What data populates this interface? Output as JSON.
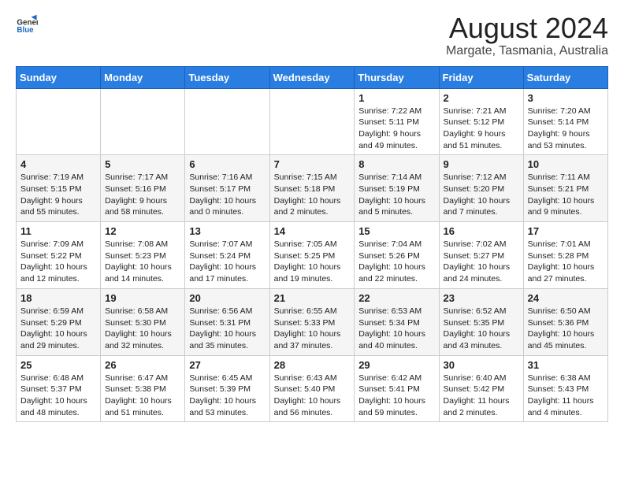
{
  "logo": {
    "text_general": "General",
    "text_blue": "Blue"
  },
  "title": "August 2024",
  "subtitle": "Margate, Tasmania, Australia",
  "days_header": [
    "Sunday",
    "Monday",
    "Tuesday",
    "Wednesday",
    "Thursday",
    "Friday",
    "Saturday"
  ],
  "weeks": [
    {
      "days": [
        {
          "num": "",
          "info": ""
        },
        {
          "num": "",
          "info": ""
        },
        {
          "num": "",
          "info": ""
        },
        {
          "num": "",
          "info": ""
        },
        {
          "num": "1",
          "info": "Sunrise: 7:22 AM\nSunset: 5:11 PM\nDaylight: 9 hours\nand 49 minutes."
        },
        {
          "num": "2",
          "info": "Sunrise: 7:21 AM\nSunset: 5:12 PM\nDaylight: 9 hours\nand 51 minutes."
        },
        {
          "num": "3",
          "info": "Sunrise: 7:20 AM\nSunset: 5:14 PM\nDaylight: 9 hours\nand 53 minutes."
        }
      ]
    },
    {
      "days": [
        {
          "num": "4",
          "info": "Sunrise: 7:19 AM\nSunset: 5:15 PM\nDaylight: 9 hours\nand 55 minutes."
        },
        {
          "num": "5",
          "info": "Sunrise: 7:17 AM\nSunset: 5:16 PM\nDaylight: 9 hours\nand 58 minutes."
        },
        {
          "num": "6",
          "info": "Sunrise: 7:16 AM\nSunset: 5:17 PM\nDaylight: 10 hours\nand 0 minutes."
        },
        {
          "num": "7",
          "info": "Sunrise: 7:15 AM\nSunset: 5:18 PM\nDaylight: 10 hours\nand 2 minutes."
        },
        {
          "num": "8",
          "info": "Sunrise: 7:14 AM\nSunset: 5:19 PM\nDaylight: 10 hours\nand 5 minutes."
        },
        {
          "num": "9",
          "info": "Sunrise: 7:12 AM\nSunset: 5:20 PM\nDaylight: 10 hours\nand 7 minutes."
        },
        {
          "num": "10",
          "info": "Sunrise: 7:11 AM\nSunset: 5:21 PM\nDaylight: 10 hours\nand 9 minutes."
        }
      ]
    },
    {
      "days": [
        {
          "num": "11",
          "info": "Sunrise: 7:09 AM\nSunset: 5:22 PM\nDaylight: 10 hours\nand 12 minutes."
        },
        {
          "num": "12",
          "info": "Sunrise: 7:08 AM\nSunset: 5:23 PM\nDaylight: 10 hours\nand 14 minutes."
        },
        {
          "num": "13",
          "info": "Sunrise: 7:07 AM\nSunset: 5:24 PM\nDaylight: 10 hours\nand 17 minutes."
        },
        {
          "num": "14",
          "info": "Sunrise: 7:05 AM\nSunset: 5:25 PM\nDaylight: 10 hours\nand 19 minutes."
        },
        {
          "num": "15",
          "info": "Sunrise: 7:04 AM\nSunset: 5:26 PM\nDaylight: 10 hours\nand 22 minutes."
        },
        {
          "num": "16",
          "info": "Sunrise: 7:02 AM\nSunset: 5:27 PM\nDaylight: 10 hours\nand 24 minutes."
        },
        {
          "num": "17",
          "info": "Sunrise: 7:01 AM\nSunset: 5:28 PM\nDaylight: 10 hours\nand 27 minutes."
        }
      ]
    },
    {
      "days": [
        {
          "num": "18",
          "info": "Sunrise: 6:59 AM\nSunset: 5:29 PM\nDaylight: 10 hours\nand 29 minutes."
        },
        {
          "num": "19",
          "info": "Sunrise: 6:58 AM\nSunset: 5:30 PM\nDaylight: 10 hours\nand 32 minutes."
        },
        {
          "num": "20",
          "info": "Sunrise: 6:56 AM\nSunset: 5:31 PM\nDaylight: 10 hours\nand 35 minutes."
        },
        {
          "num": "21",
          "info": "Sunrise: 6:55 AM\nSunset: 5:33 PM\nDaylight: 10 hours\nand 37 minutes."
        },
        {
          "num": "22",
          "info": "Sunrise: 6:53 AM\nSunset: 5:34 PM\nDaylight: 10 hours\nand 40 minutes."
        },
        {
          "num": "23",
          "info": "Sunrise: 6:52 AM\nSunset: 5:35 PM\nDaylight: 10 hours\nand 43 minutes."
        },
        {
          "num": "24",
          "info": "Sunrise: 6:50 AM\nSunset: 5:36 PM\nDaylight: 10 hours\nand 45 minutes."
        }
      ]
    },
    {
      "days": [
        {
          "num": "25",
          "info": "Sunrise: 6:48 AM\nSunset: 5:37 PM\nDaylight: 10 hours\nand 48 minutes."
        },
        {
          "num": "26",
          "info": "Sunrise: 6:47 AM\nSunset: 5:38 PM\nDaylight: 10 hours\nand 51 minutes."
        },
        {
          "num": "27",
          "info": "Sunrise: 6:45 AM\nSunset: 5:39 PM\nDaylight: 10 hours\nand 53 minutes."
        },
        {
          "num": "28",
          "info": "Sunrise: 6:43 AM\nSunset: 5:40 PM\nDaylight: 10 hours\nand 56 minutes."
        },
        {
          "num": "29",
          "info": "Sunrise: 6:42 AM\nSunset: 5:41 PM\nDaylight: 10 hours\nand 59 minutes."
        },
        {
          "num": "30",
          "info": "Sunrise: 6:40 AM\nSunset: 5:42 PM\nDaylight: 11 hours\nand 2 minutes."
        },
        {
          "num": "31",
          "info": "Sunrise: 6:38 AM\nSunset: 5:43 PM\nDaylight: 11 hours\nand 4 minutes."
        }
      ]
    }
  ]
}
